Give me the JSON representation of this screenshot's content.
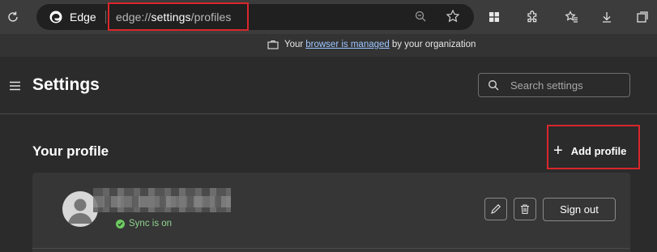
{
  "browser": {
    "name": "Edge",
    "url_scheme": "edge://",
    "url_host": "settings",
    "url_path": "/profiles"
  },
  "managed_bar": {
    "prefix": "Your",
    "link": "browser is managed",
    "suffix": "by your organization"
  },
  "header": {
    "title": "Settings",
    "search_placeholder": "Search settings"
  },
  "profile_section": {
    "title": "Your profile",
    "add_profile_label": "Add profile",
    "sync_status": "Sync is on",
    "sign_out_label": "Sign out"
  },
  "colors": {
    "highlight": "#d9262b",
    "sync_green": "#6ccb5f",
    "link": "#9cc6ff"
  }
}
